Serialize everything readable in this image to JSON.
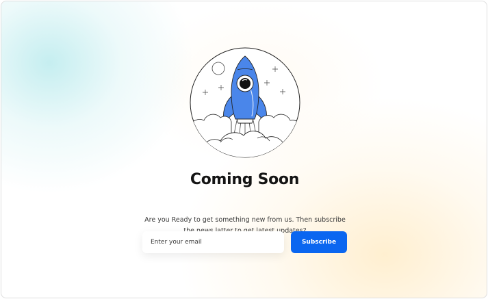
{
  "page": {
    "title": "Coming Soon",
    "subtitle": "Are you Ready to get something new from us. Then subscribe the news latter to get latest updates?"
  },
  "form": {
    "email_placeholder": "Enter your email",
    "email_value": "",
    "subscribe_label": "Subscribe"
  },
  "colors": {
    "accent": "#0a66f0",
    "rocket": "#4a86ea",
    "title": "#141414"
  },
  "icons": {
    "illustration": "rocket-launch-illustration"
  }
}
